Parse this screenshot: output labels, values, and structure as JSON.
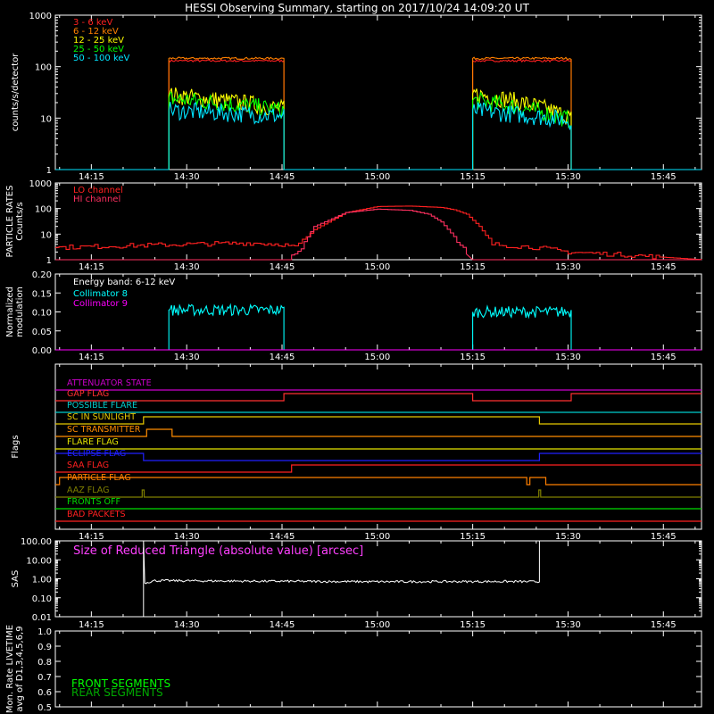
{
  "title": "HESSI Observing Summary, starting on 2017/10/24 14:09:20 UT",
  "time_ticks": [
    "14:15",
    "14:30",
    "14:45",
    "15:00",
    "15:15",
    "15:30",
    "15:45"
  ],
  "time_tick_minutes": [
    15,
    30,
    45,
    60,
    75,
    90,
    105
  ],
  "time_range_minutes": [
    9.333,
    111
  ],
  "chart_data": [
    {
      "type": "line",
      "name": "count-rates",
      "ylabel": "counts/s/detector",
      "ylog": true,
      "ylim": [
        1,
        1000
      ],
      "yticks": [
        "1",
        "10",
        "100",
        "1000"
      ],
      "ytick_values": [
        1,
        10,
        100,
        1000
      ],
      "legend": "top-left",
      "series": [
        {
          "name": "3 - 6 keV",
          "color": "#ff2020",
          "x": [
            9.33,
            27.2,
            27.2,
            45.3,
            45.3,
            75.0,
            75.0,
            90.5,
            90.5,
            111
          ],
          "y": [
            1,
            1,
            130,
            130,
            1,
            1,
            130,
            130,
            1,
            1
          ]
        },
        {
          "name": "6 - 12 keV",
          "color": "#ff8000",
          "x": [
            9.33,
            27.2,
            27.2,
            45.3,
            45.3,
            75.0,
            75.0,
            90.5,
            90.5,
            111
          ],
          "y": [
            1,
            1,
            145,
            145,
            1,
            1,
            145,
            145,
            1,
            1
          ]
        },
        {
          "name": "12 - 25 keV",
          "color": "#ffff00",
          "x": [
            9.33,
            27.2,
            27.2,
            45.3,
            45.3,
            75.0,
            75.0,
            90.5,
            90.5,
            111
          ],
          "y": [
            1,
            1,
            28,
            15,
            1,
            1,
            30,
            10,
            1,
            1
          ]
        },
        {
          "name": "25 - 50 keV",
          "color": "#00ff00",
          "x": [
            9.33,
            27.2,
            27.2,
            45.3,
            45.3,
            75.0,
            75.0,
            90.5,
            90.5,
            111
          ],
          "y": [
            1,
            1,
            24,
            14,
            1,
            1,
            22,
            9,
            1,
            1
          ]
        },
        {
          "name": "50 - 100 keV",
          "color": "#00e5ff",
          "x": [
            9.33,
            27.2,
            27.2,
            45.3,
            45.3,
            75.0,
            75.0,
            90.5,
            90.5,
            111
          ],
          "y": [
            1,
            1,
            14,
            11,
            1,
            1,
            14,
            9,
            1,
            1
          ]
        }
      ]
    },
    {
      "type": "line",
      "name": "particle-rates",
      "ylabel": "PARTICLE RATES Counts/s",
      "ylog": true,
      "ylim": [
        1,
        1000
      ],
      "yticks": [
        "1",
        "10",
        "100",
        "1000"
      ],
      "ytick_values": [
        1,
        10,
        100,
        1000
      ],
      "legend": "top-left",
      "series": [
        {
          "name": "LO channel",
          "color": "#ff2020",
          "x": [
            9.33,
            20,
            30,
            40,
            45,
            47,
            50,
            55,
            60,
            65,
            70,
            72,
            74,
            76,
            78,
            85,
            90,
            100,
            111
          ],
          "y": [
            3,
            3.5,
            4,
            4.5,
            4,
            3,
            15,
            70,
            120,
            125,
            110,
            90,
            60,
            20,
            4,
            3,
            2,
            1.5,
            1
          ]
        },
        {
          "name": "HI channel",
          "color": "#ff3060",
          "x": [
            9.33,
            46,
            48,
            50,
            55,
            60,
            65,
            68,
            70,
            72,
            74,
            75,
            111
          ],
          "y": [
            1,
            1,
            3,
            20,
            70,
            95,
            85,
            60,
            30,
            8,
            2,
            1,
            1
          ]
        }
      ]
    },
    {
      "type": "line",
      "name": "modulation",
      "ylabel": "Normalized modulation",
      "ylim": [
        0,
        0.2
      ],
      "yticks": [
        "0.00",
        "0.05",
        "0.10",
        "0.15",
        "0.20"
      ],
      "ytick_values": [
        0,
        0.05,
        0.1,
        0.15,
        0.2
      ],
      "annotation": "Energy band: 6-12 keV",
      "legend": "top-left",
      "series": [
        {
          "name": "Collimator 8",
          "color": "#00ffff",
          "x": [
            9.33,
            27.2,
            27.2,
            45.3,
            45.3,
            75.0,
            75.0,
            90.5,
            90.5,
            111
          ],
          "y": [
            0,
            0,
            0.105,
            0.105,
            0,
            0,
            0.1,
            0.1,
            0,
            0
          ]
        },
        {
          "name": "Collimator 9",
          "color": "#ff00ff",
          "x": [
            9.33,
            111
          ],
          "y": [
            0,
            0
          ]
        }
      ]
    },
    {
      "type": "line",
      "name": "flags",
      "ylabel": "Flags",
      "series": [
        {
          "name": "ATTENUATOR STATE",
          "color": "#cc00cc",
          "x": [
            9.33,
            111
          ],
          "y": [
            0,
            0
          ]
        },
        {
          "name": "GAP FLAG",
          "color": "#ff3030",
          "x": [
            9.33,
            45.3,
            45.3,
            75.0,
            75.0,
            90.5,
            90.5,
            111
          ],
          "y": [
            0,
            0,
            1,
            1,
            0,
            0,
            1,
            1
          ]
        },
        {
          "name": "POSSIBLE FLARE",
          "color": "#00cccc",
          "x": [
            9.33,
            111
          ],
          "y": [
            0,
            0
          ]
        },
        {
          "name": "SC IN SUNLIGHT",
          "color": "#e6c800",
          "x": [
            9.33,
            23.2,
            23.2,
            85.5,
            85.5,
            111
          ],
          "y": [
            0,
            0,
            1,
            1,
            0,
            0
          ]
        },
        {
          "name": "SC TRANSMITTER",
          "color": "#ff8c00",
          "x": [
            9.33,
            23.7,
            23.7,
            27.7,
            27.7,
            111
          ],
          "y": [
            0,
            0,
            1,
            1,
            0,
            0
          ]
        },
        {
          "name": "FLARE FLAG",
          "color": "#e6e600",
          "x": [
            9.33,
            111
          ],
          "y": [
            0,
            0
          ]
        },
        {
          "name": "ECLIPSE FLAG",
          "color": "#2020ff",
          "x": [
            9.33,
            23.2,
            23.2,
            85.5,
            85.5,
            111
          ],
          "y": [
            1,
            1,
            0,
            0,
            1,
            1
          ]
        },
        {
          "name": "SAA FLAG",
          "color": "#ff2020",
          "x": [
            9.33,
            46.5,
            46.5,
            111
          ],
          "y": [
            0,
            0,
            1,
            1
          ]
        },
        {
          "name": "PARTICLE FLAG",
          "color": "#ff7f00",
          "x": [
            9.33,
            10.0,
            10.0,
            83.5,
            83.5,
            84.0,
            84.0,
            86.5,
            86.5,
            111
          ],
          "y": [
            0,
            0,
            1,
            1,
            0,
            0,
            1,
            1,
            0,
            0
          ]
        },
        {
          "name": "AAZ FLAG",
          "color": "#808000",
          "x": [
            9.33,
            23.0,
            23.0,
            23.3,
            23.3,
            85.4,
            85.4,
            85.7,
            85.7,
            111
          ],
          "y": [
            0,
            0,
            1,
            1,
            0,
            0,
            1,
            1,
            0,
            0
          ]
        },
        {
          "name": "FRONTS OFF",
          "color": "#00dd00",
          "x": [
            9.33,
            111
          ],
          "y": [
            0,
            0
          ]
        },
        {
          "name": "BAD PACKETS",
          "color": "#ff2020",
          "x": [
            9.33,
            111
          ],
          "y": [
            0,
            0
          ]
        }
      ]
    },
    {
      "type": "line",
      "name": "sas",
      "ylabel": "SAS",
      "ylog": true,
      "ylim": [
        0.01,
        100
      ],
      "yticks": [
        "0.01",
        "0.10",
        "1.00",
        "10.00",
        "100.00"
      ],
      "ytick_values": [
        0.01,
        0.1,
        1,
        10,
        100
      ],
      "annotation": "Size of Reduced Triangle (absolute value) [arcsec]",
      "series": [
        {
          "name": "",
          "color": "#ffffff",
          "x": [
            23.2,
            23.2,
            23.4,
            25,
            40,
            60,
            80,
            85.5,
            85.5
          ],
          "y": [
            0.01,
            100,
            0.6,
            0.8,
            0.75,
            0.7,
            0.72,
            0.7,
            100
          ]
        }
      ]
    },
    {
      "type": "line",
      "name": "livetime",
      "ylabel": "Mon. Rate LIVETIME avg of D1,3,4,5,6,9",
      "ylim": [
        0.5,
        1.0
      ],
      "yticks": [
        "0.5",
        "0.6",
        "0.7",
        "0.8",
        "0.9",
        "1.0"
      ],
      "ytick_values": [
        0.5,
        0.6,
        0.7,
        0.8,
        0.9,
        1.0
      ],
      "legend": "bottom-left",
      "series": [
        {
          "name": "FRONT SEGMENTS",
          "color": "#00ff00",
          "x": [],
          "y": []
        },
        {
          "name": "REAR SEGMENTS",
          "color": "#00aa00",
          "x": [],
          "y": []
        }
      ]
    }
  ]
}
